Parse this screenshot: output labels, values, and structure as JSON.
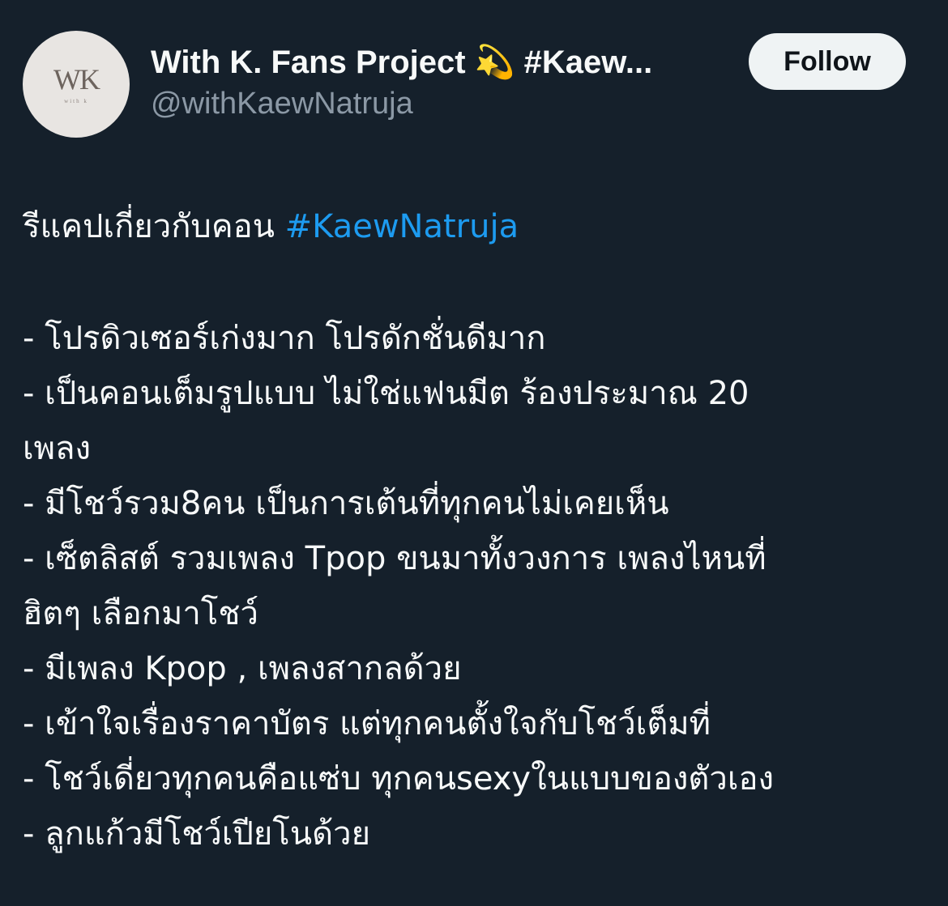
{
  "author": {
    "avatar_logo": "WK",
    "avatar_sub": "with k",
    "display_name": "With K. Fans Project 💫 #Kaew...",
    "handle": "@withKaewNatruja"
  },
  "follow_label": "Follow",
  "tweet": {
    "intro": "รีแคปเกี่ยวกับคอน",
    "hashtag": "#KaewNatruja",
    "lines": [
      "- โปรดิวเซอร์เก่งมาก โปรดักชั่นดีมาก",
      "- เป็นคอนเต็มรูปแบบ ไม่ใช่แฟนมีต ร้องประมาณ 20",
      "เพลง",
      "- มีโชว์รวม8คน เป็นการเต้นที่ทุกคนไม่เคยเห็น",
      "- เซ็ตลิสต์ รวมเพลง Tpop ขนมาทั้งวงการ เพลงไหนที่",
      "ฮิตๆ เลือกมาโชว์",
      "- มีเพลง Kpop , เพลงสากลด้วย",
      "- เข้าใจเรื่องราคาบัตร แต่ทุกคนตั้งใจกับโชว์เต็มที่",
      "- โชว์เดี่ยวทุกคนคือแซ่บ ทุกคนsexyในแบบของตัวเอง",
      "- ลูกแก้วมีโชว์เปียโนด้วย"
    ]
  },
  "colors": {
    "background": "#15202b",
    "text": "#f7f9f9",
    "secondary_text": "#8b98a5",
    "link": "#1d9bf0",
    "button_bg": "#eff3f4"
  }
}
